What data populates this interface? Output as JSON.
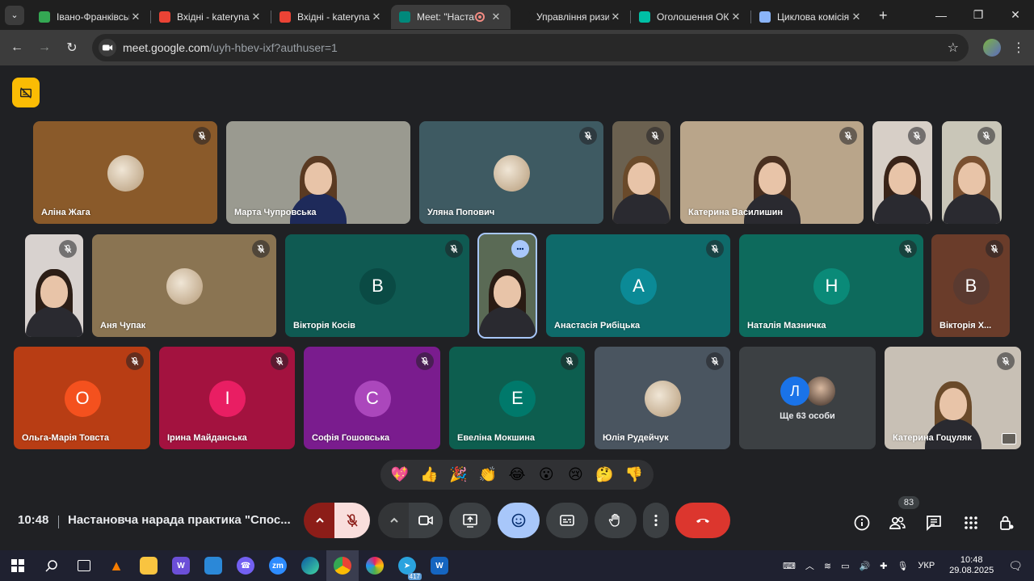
{
  "browser": {
    "tabs": [
      {
        "title": "Івано-Франківськ",
        "favicon": "sheet-icon",
        "color": "#34a853"
      },
      {
        "title": "Вхідні - kateryna",
        "favicon": "gmail-icon",
        "color": "#ea4335"
      },
      {
        "title": "Вхідні - kateryna",
        "favicon": "gmail-icon",
        "color": "#ea4335"
      },
      {
        "title": "Meet: \"Настановча",
        "favicon": "meet-icon",
        "color": "#00897b",
        "active": true
      },
      {
        "title": "Управління ризиками",
        "favicon": "blank-icon",
        "color": "#1f1f1f"
      },
      {
        "title": "Оголошення ОК",
        "favicon": "classroom-icon",
        "color": "#00bfa5"
      },
      {
        "title": "Циклова комісія",
        "favicon": "site-icon",
        "color": "#8ab4f8"
      }
    ],
    "url_host": "meet.google.com",
    "url_path": "/uyh-hbev-ixf?authuser=1"
  },
  "participants": [
    {
      "name": "Аліна Жага",
      "muted": true,
      "type": "image",
      "bg": "#8a5a2a"
    },
    {
      "name": "Марта Чупровська",
      "muted": false,
      "type": "video",
      "bg": "#9a9a90"
    },
    {
      "name": "Уляна Попович",
      "muted": true,
      "type": "image",
      "bg": "#3e5a62"
    },
    {
      "name": "",
      "muted": true,
      "type": "video",
      "bg": "#6b6150"
    },
    {
      "name": "Катерина Василишин",
      "muted": true,
      "type": "video",
      "bg": "#b9a58a"
    },
    {
      "name": "",
      "muted": true,
      "type": "video",
      "bg": "#d7cfc7"
    },
    {
      "name": "",
      "muted": true,
      "type": "video",
      "bg": "#c9c6b8"
    },
    {
      "name": "",
      "muted": true,
      "type": "video",
      "bg": "#d8d2cf"
    },
    {
      "name": "Аня Чупак",
      "muted": true,
      "type": "image",
      "bg": "#8a7452"
    },
    {
      "name": "Вікторія Косів",
      "muted": true,
      "type": "letter",
      "letter": "В",
      "bg": "#0f5a52",
      "avatar": "#0a4a44"
    },
    {
      "name": "",
      "muted": false,
      "type": "video",
      "bg": "#5a6a55",
      "speaking": true
    },
    {
      "name": "Анастасія Рибіцька",
      "muted": true,
      "type": "letter",
      "letter": "А",
      "bg": "#0e6a6a",
      "avatar": "#0b8a96"
    },
    {
      "name": "Наталія Мазничка",
      "muted": true,
      "type": "letter",
      "letter": "Н",
      "bg": "#0d6a5c",
      "avatar": "#0a8a78"
    },
    {
      "name": "Вікторія Х...",
      "muted": true,
      "type": "letter",
      "letter": "В",
      "bg": "#6a3c2a",
      "avatar": "#5a3a30"
    },
    {
      "name": "Ольга-Марія Товста",
      "muted": true,
      "type": "letter",
      "letter": "О",
      "bg": "#b83d14",
      "avatar": "#f4511e"
    },
    {
      "name": "Ірина Майданська",
      "muted": true,
      "type": "letter",
      "letter": "І",
      "bg": "#a3123f",
      "avatar": "#e91e63"
    },
    {
      "name": "Софія Гошовська",
      "muted": true,
      "type": "letter",
      "letter": "С",
      "bg": "#7a1c8e",
      "avatar": "#ab47bc"
    },
    {
      "name": "Евеліна Мокшина",
      "muted": true,
      "type": "letter",
      "letter": "Е",
      "bg": "#0d5e4f",
      "avatar": "#00796b"
    },
    {
      "name": "Юлія Рудейчук",
      "muted": true,
      "type": "image",
      "bg": "#4a5560"
    },
    {
      "name": "Катерина Гоцуляк",
      "muted": true,
      "type": "video",
      "bg": "#c8c0b5"
    }
  ],
  "others": {
    "label": "Ще 63 особи",
    "letter": "Л"
  },
  "reactions": [
    "💖",
    "👍",
    "🎉",
    "👏",
    "😂",
    "😮",
    "😢",
    "🤔",
    "👎"
  ],
  "meeting": {
    "time": "10:48",
    "title": "Настановча нарада практика \"Спос...",
    "participant_count": "83"
  },
  "taskbar": {
    "lang": "УКР",
    "time": "10:48",
    "date": "29.08.2025",
    "telegram_badge": "417"
  }
}
